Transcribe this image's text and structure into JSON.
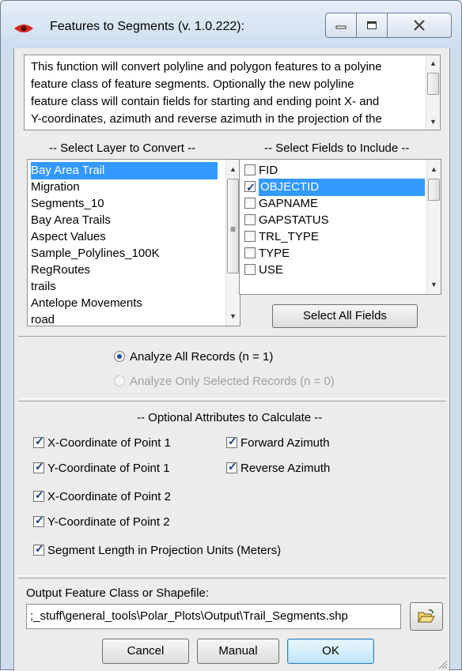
{
  "window": {
    "title": "Features to Segments (v. 1.0.222):",
    "colors": {
      "accent_red": "#d42a1e",
      "selection": "#3399ff"
    }
  },
  "description": {
    "lines": [
      "This function will convert polyline and polygon features to a polyine",
      "feature class of feature segments.  Optionally the new polyline",
      "feature class will contain fields for starting and ending point X- and",
      "Y-coordinates, azimuth and reverse azimuth in the projection of the"
    ]
  },
  "layers": {
    "label": "-- Select Layer to Convert --",
    "items": [
      "Bay Area Trail",
      "Migration",
      "Segments_10",
      "Bay Area Trails",
      "Aspect Values",
      "Sample_Polylines_100K",
      "RegRoutes",
      "trails",
      "Antelope Movements",
      "road"
    ],
    "selected_index": 0
  },
  "fields": {
    "label": "-- Select Fields to Include --",
    "items": [
      {
        "name": "FID",
        "checked": false
      },
      {
        "name": "OBJECTID",
        "checked": true
      },
      {
        "name": "GAPNAME",
        "checked": false
      },
      {
        "name": "GAPSTATUS",
        "checked": false
      },
      {
        "name": "TRL_TYPE",
        "checked": false
      },
      {
        "name": "TYPE",
        "checked": false
      },
      {
        "name": "USE",
        "checked": false
      }
    ],
    "selected_index": 1,
    "select_all_label": "Select All Fields"
  },
  "records": {
    "all_label": "Analyze All Records (n = 1)",
    "selected_label": "Analyze Only Selected Records (n = 0)",
    "choice": "all"
  },
  "attributes": {
    "label": "-- Optional Attributes to Calculate --",
    "x1": {
      "label": "X-Coordinate of Point 1",
      "checked": true
    },
    "y1": {
      "label": "Y-Coordinate of Point 1",
      "checked": true
    },
    "x2": {
      "label": "X-Coordinate of Point 2",
      "checked": true
    },
    "y2": {
      "label": "Y-Coordinate of Point 2",
      "checked": true
    },
    "forward": {
      "label": "Forward Azimuth",
      "checked": true
    },
    "reverse": {
      "label": "Reverse Azimuth",
      "checked": true
    },
    "length": {
      "label": "Segment Length in Projection Units (Meters)",
      "checked": true
    }
  },
  "output": {
    "label": "Output Feature Class or Shapefile:",
    "value": ";_stuff\\general_tools\\Polar_Plots\\Output\\Trail_Segments.shp"
  },
  "buttons": {
    "cancel": "Cancel",
    "manual": "Manual",
    "ok": "OK"
  }
}
